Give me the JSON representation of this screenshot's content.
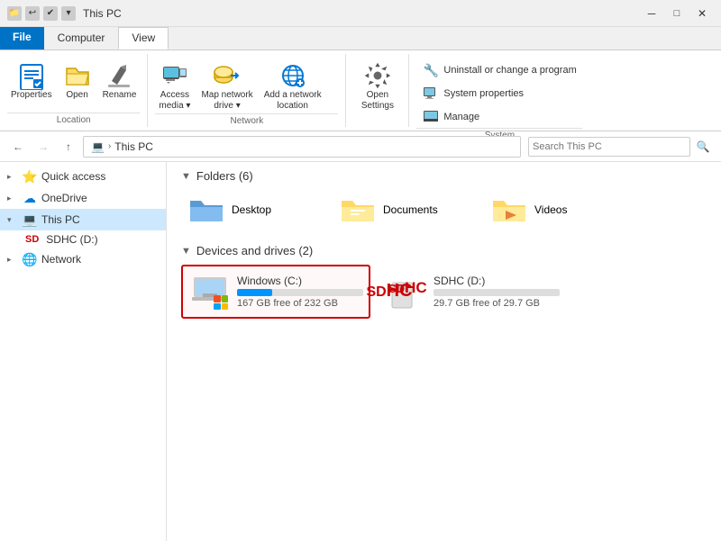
{
  "titleBar": {
    "title": "This PC",
    "icons": [
      "⬛",
      "🔲",
      "▭"
    ]
  },
  "ribbon": {
    "tabs": [
      "File",
      "Computer",
      "View"
    ],
    "activeTab": "Computer",
    "groups": {
      "location": {
        "label": "Location",
        "buttons": [
          {
            "id": "properties",
            "icon": "✔",
            "label": "Properties"
          },
          {
            "id": "open",
            "icon": "📂",
            "label": "Open"
          },
          {
            "id": "rename",
            "icon": "✏",
            "label": "Rename"
          }
        ]
      },
      "network": {
        "label": "Network",
        "buttons": [
          {
            "id": "access-media",
            "icon": "🖥",
            "label": "Access\nmedia ▾"
          },
          {
            "id": "map-network",
            "icon": "🗂",
            "label": "Map network\ndrive ▾"
          },
          {
            "id": "add-network",
            "icon": "🌐",
            "label": "Add a network\nlocation"
          }
        ]
      },
      "openSettings": {
        "label": "",
        "button": {
          "id": "open-settings",
          "icon": "⚙",
          "label": "Open\nSettings"
        }
      },
      "system": {
        "label": "System",
        "buttons": [
          {
            "id": "uninstall",
            "icon": "🔧",
            "label": "Uninstall or change a program"
          },
          {
            "id": "sys-props",
            "icon": "🖥",
            "label": "System properties"
          },
          {
            "id": "manage",
            "icon": "💻",
            "label": "Manage"
          }
        ]
      }
    }
  },
  "navBar": {
    "backDisabled": false,
    "forwardDisabled": true,
    "upDisabled": false,
    "breadcrumb": [
      "This PC"
    ],
    "addressText": "This PC"
  },
  "sidebar": {
    "items": [
      {
        "id": "quick-access",
        "label": "Quick access",
        "icon": "⭐",
        "expanded": false,
        "indent": 0
      },
      {
        "id": "onedrive",
        "label": "OneDrive",
        "icon": "☁",
        "expanded": false,
        "indent": 0
      },
      {
        "id": "this-pc",
        "label": "This PC",
        "icon": "💻",
        "expanded": true,
        "active": true,
        "indent": 0
      },
      {
        "id": "sdhc",
        "label": "SDHC (D:)",
        "icon": "SD",
        "indent": 1
      },
      {
        "id": "network",
        "label": "Network",
        "icon": "🌐",
        "indent": 0
      }
    ]
  },
  "content": {
    "foldersSection": {
      "label": "Folders (6)",
      "collapsed": false,
      "folders": [
        {
          "id": "desktop",
          "label": "Desktop",
          "icon": "folder-blue"
        },
        {
          "id": "documents",
          "label": "Documents",
          "icon": "folder-docs"
        },
        {
          "id": "videos",
          "label": "Videos",
          "icon": "folder-video"
        }
      ]
    },
    "drivesSection": {
      "label": "Devices and drives (2)",
      "collapsed": false,
      "drives": [
        {
          "id": "windows-c",
          "name": "Windows (C:)",
          "freeSpace": "167 GB free of 232 GB",
          "fillPercent": 28,
          "selected": true,
          "iconType": "windows"
        },
        {
          "id": "sdhc-d",
          "name": "SDHC (D:)",
          "freeSpace": "29.7 GB free of 29.7 GB",
          "fillPercent": 0,
          "selected": false,
          "iconType": "sdhc"
        }
      ]
    }
  }
}
